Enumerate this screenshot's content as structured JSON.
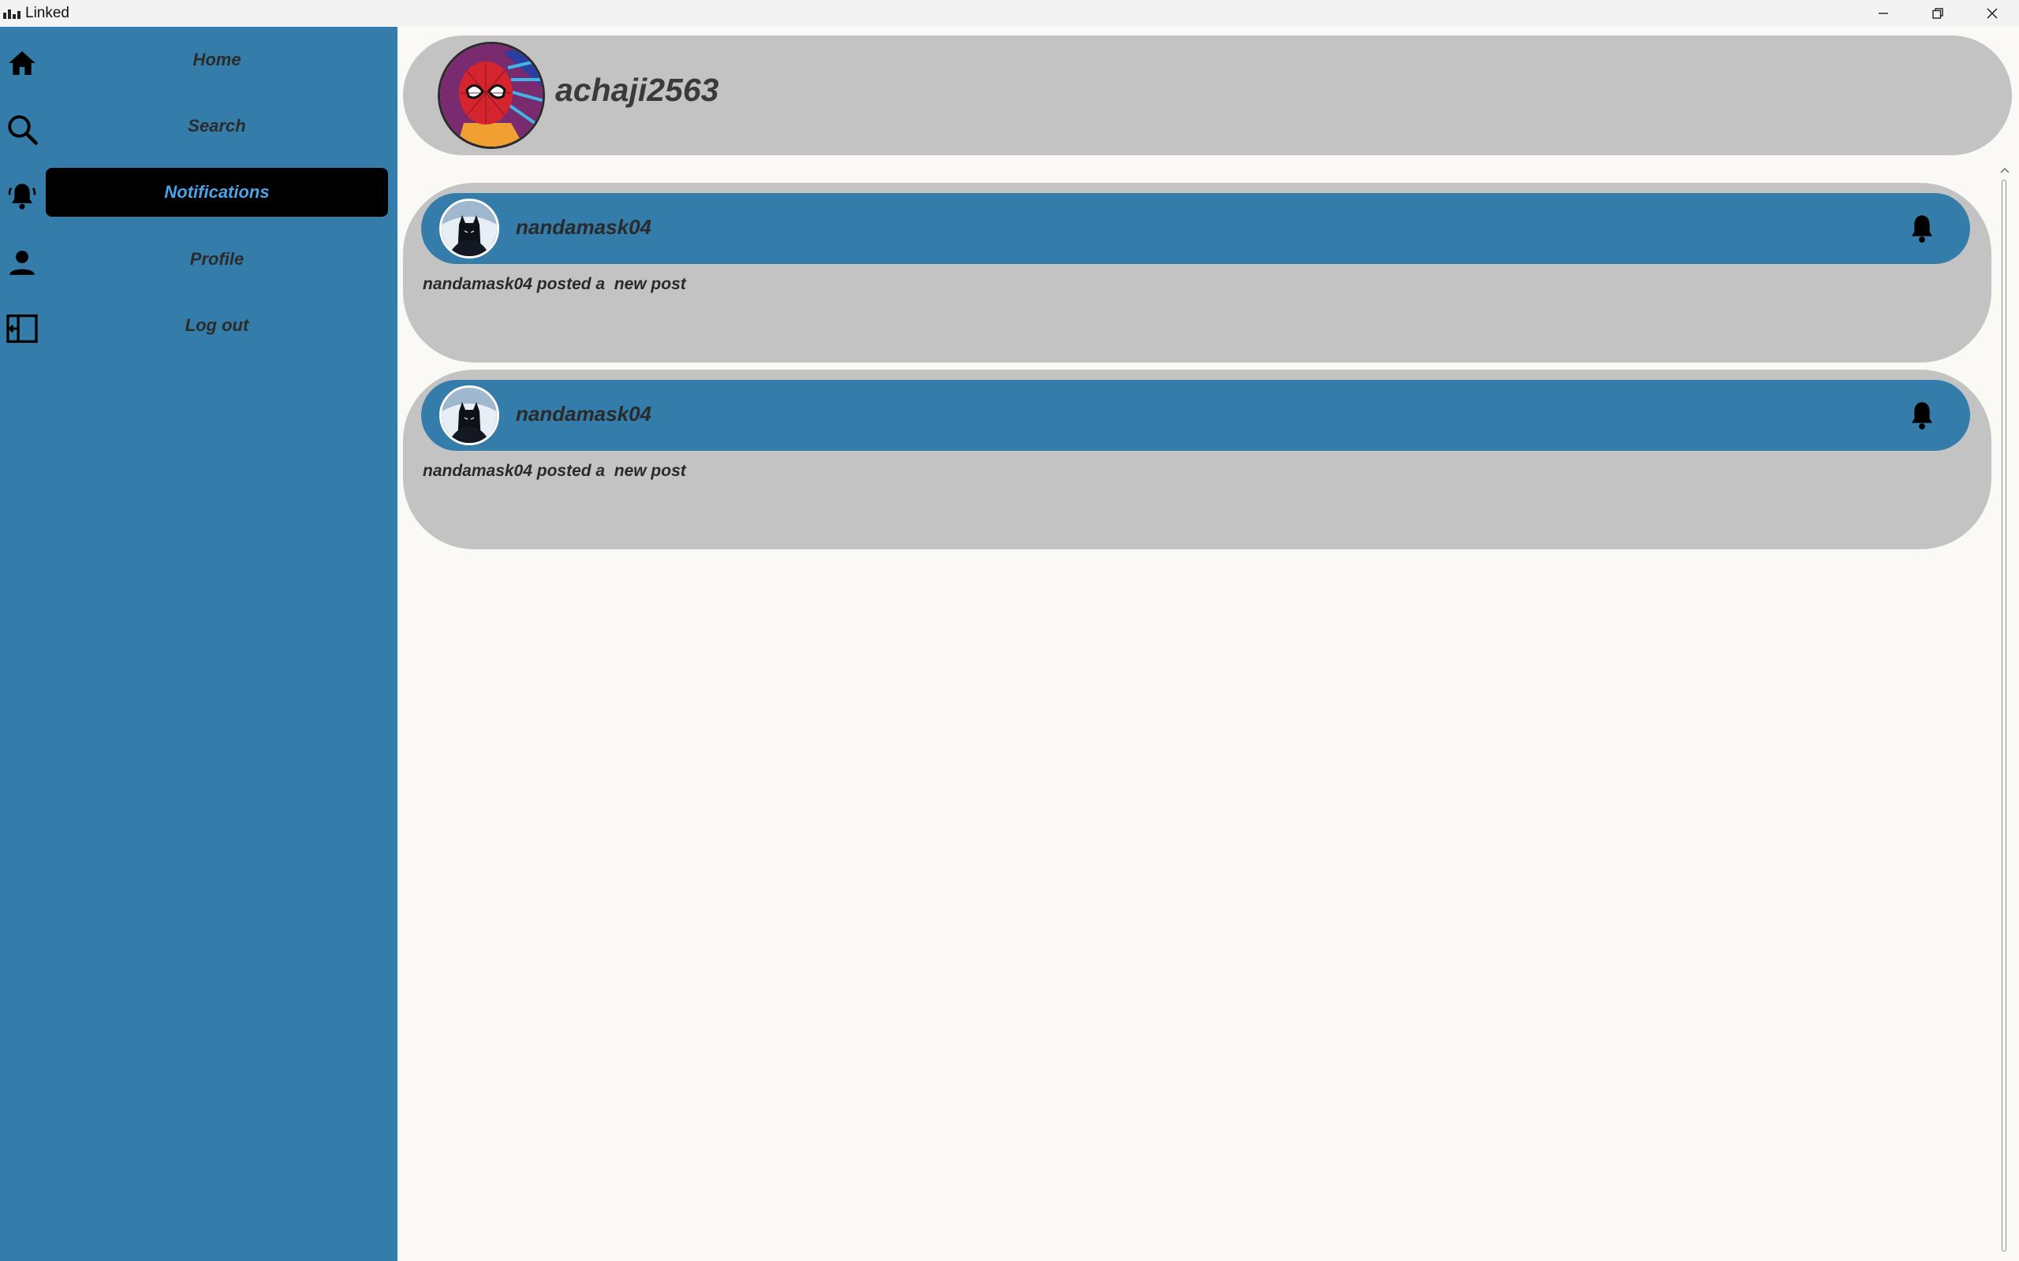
{
  "window": {
    "title": "Linked",
    "controls": [
      "minimize",
      "restore",
      "close"
    ]
  },
  "sidebar": {
    "items": [
      {
        "label": "Home",
        "icon": "home-icon"
      },
      {
        "label": "Search",
        "icon": "search-icon"
      },
      {
        "label": "Notifications",
        "icon": "notification-bell-icon",
        "active": true
      },
      {
        "label": "Profile",
        "icon": "person-icon"
      },
      {
        "label": "Log out",
        "icon": "logout-icon"
      }
    ]
  },
  "header": {
    "username": "achaji2563"
  },
  "notifications": [
    {
      "user": "nandamask04",
      "message": "nandamask04 posted a  new post"
    },
    {
      "user": "nandamask04",
      "message": "nandamask04 posted a  new post"
    }
  ],
  "colors": {
    "sidebar": "#347ca9",
    "card": "#c3c3c3",
    "active_bg": "#000000",
    "active_text": "#4aa3e8",
    "background": "#faf9f5"
  }
}
